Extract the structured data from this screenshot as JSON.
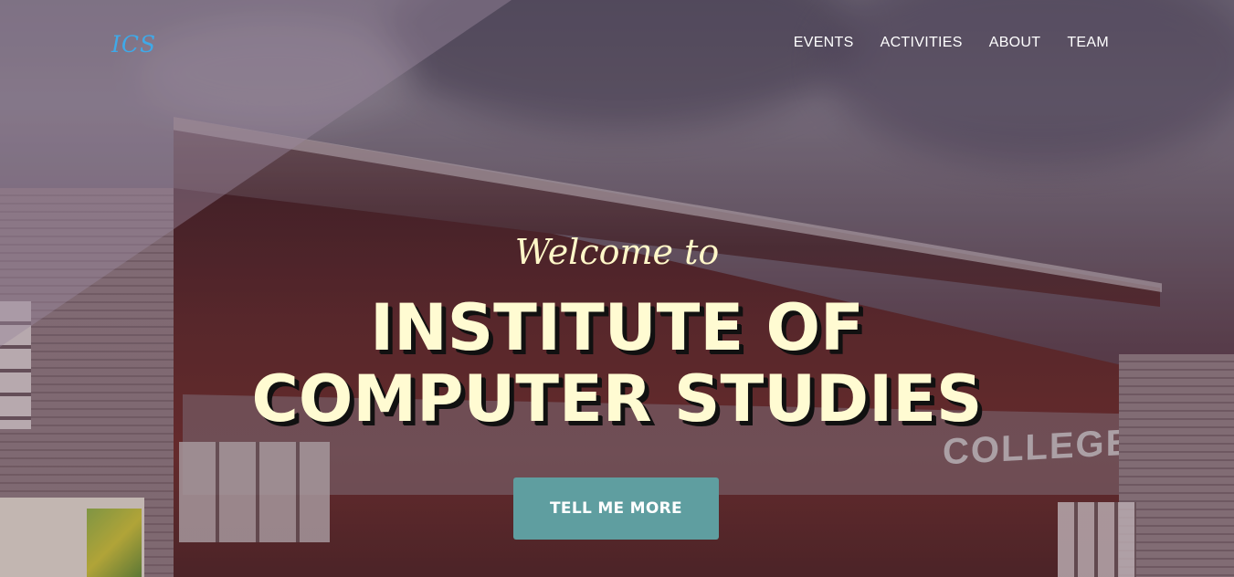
{
  "nav": {
    "brand": "ICS",
    "links": [
      "EVENTS",
      "ACTIVITIES",
      "ABOUT",
      "TEAM"
    ]
  },
  "hero": {
    "subheading": "Welcome to",
    "heading": "INSTITUTE OF COMPUTER STUDIES",
    "button_label": "TELL ME MORE",
    "background_sign_text": "COLLEGE"
  },
  "colors": {
    "brand": "#3fa9e8",
    "heading": "#fffbd2",
    "button": "#5f9ea0"
  }
}
